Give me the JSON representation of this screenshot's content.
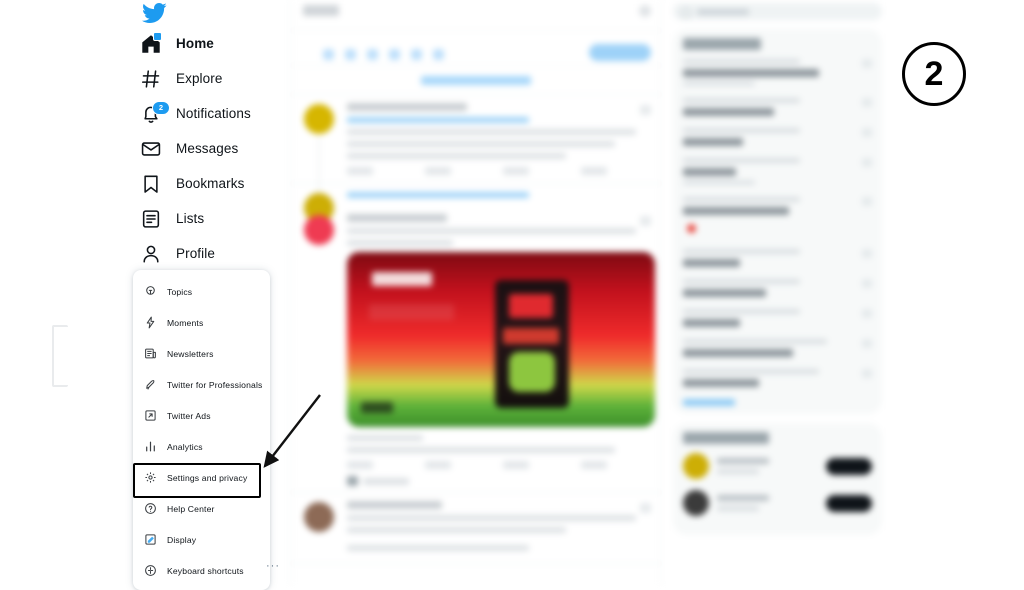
{
  "app": {
    "name": "Twitter",
    "logo_icon": "twitter-bird-icon"
  },
  "sidebar": {
    "items": [
      {
        "label": "Home",
        "icon": "home-icon",
        "active": true,
        "indicator": "blue-dot"
      },
      {
        "label": "Explore",
        "icon": "hashtag-icon",
        "active": false,
        "indicator": ""
      },
      {
        "label": "Notifications",
        "icon": "bell-icon",
        "active": false,
        "indicator": "badge",
        "badge_count": "2"
      },
      {
        "label": "Messages",
        "icon": "envelope-icon",
        "active": false,
        "indicator": ""
      },
      {
        "label": "Bookmarks",
        "icon": "bookmark-icon",
        "active": false,
        "indicator": ""
      },
      {
        "label": "Lists",
        "icon": "list-icon",
        "active": false,
        "indicator": ""
      },
      {
        "label": "Profile",
        "icon": "person-icon",
        "active": false,
        "indicator": ""
      }
    ]
  },
  "more_menu": {
    "overflow_label": "···",
    "items": [
      {
        "label": "Topics",
        "icon": "topics-icon",
        "highlighted": false
      },
      {
        "label": "Moments",
        "icon": "lightning-icon",
        "highlighted": false
      },
      {
        "label": "Newsletters",
        "icon": "newsletter-icon",
        "highlighted": false
      },
      {
        "label": "Twitter for Professionals",
        "icon": "rocket-icon",
        "highlighted": false
      },
      {
        "label": "Twitter Ads",
        "icon": "external-link-icon",
        "highlighted": false
      },
      {
        "label": "Analytics",
        "icon": "bar-chart-icon",
        "highlighted": false
      },
      {
        "label": "Settings and privacy",
        "icon": "gear-icon",
        "highlighted": true
      },
      {
        "label": "Help Center",
        "icon": "question-circle-icon",
        "highlighted": false
      },
      {
        "label": "Display",
        "icon": "display-icon",
        "highlighted": false
      },
      {
        "label": "Keyboard shortcuts",
        "icon": "keyboard-icon",
        "highlighted": false
      }
    ]
  },
  "annotation": {
    "step_number": "2",
    "arrow_icon": "arrow-pointing-down-left",
    "highlight_target": "Settings and privacy",
    "highlight_color": "#000000"
  },
  "colors": {
    "brand_blue": "#1d9bf0",
    "text_primary": "#0f1419",
    "text_secondary": "#5b7083",
    "border": "#eff3f4",
    "panel_bg": "#f7f9f9"
  },
  "timeline": {
    "blurred": true,
    "note": "Center timeline content is visually blurred in the screenshot"
  },
  "rightbar": {
    "blurred": true,
    "note": "Right sidebar trends and who-to-follow content is visually blurred"
  }
}
